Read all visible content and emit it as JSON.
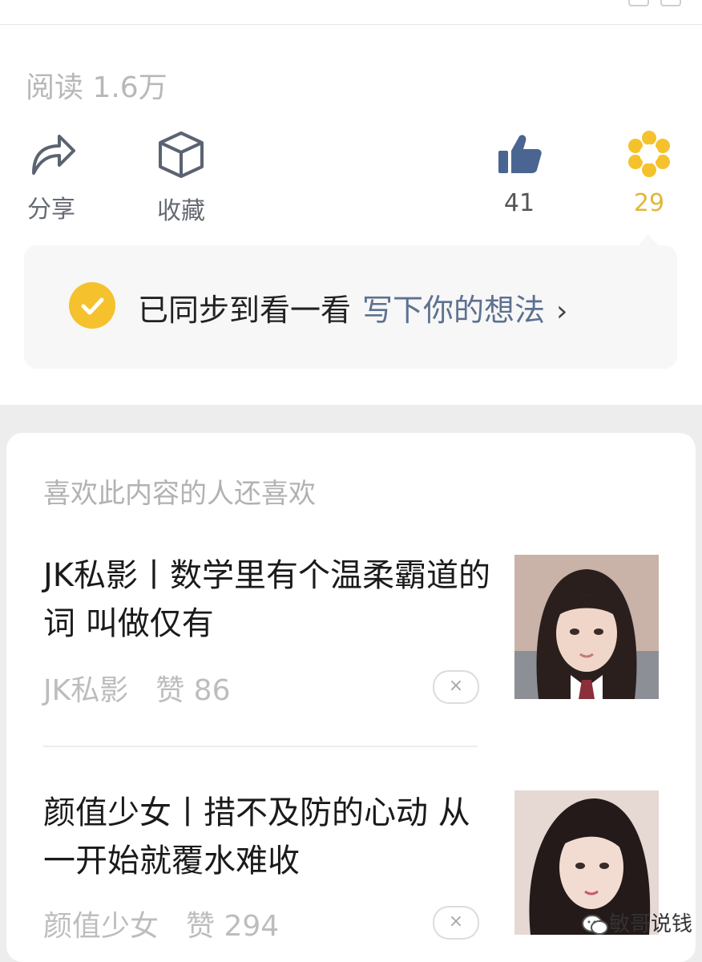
{
  "stats": {
    "read_label": "阅读 1.6万"
  },
  "actions": {
    "share_label": "分享",
    "favorite_label": "收藏",
    "like_count": "41",
    "wow_count": "29"
  },
  "comment_box": {
    "synced_text": "已同步到看一看",
    "write_link": "写下你的想法",
    "arrow": "›"
  },
  "recommendations": {
    "heading": "喜欢此内容的人还喜欢",
    "items": [
      {
        "title": "JK私影丨数学里有个温柔霸道的词 叫做仅有",
        "author": "JK私影",
        "likes": "赞 86",
        "dismiss": "×"
      },
      {
        "title": "颜值少女丨措不及防的心动 从一开始就覆水难收",
        "author": "颜值少女",
        "likes": "赞 294",
        "dismiss": "×"
      }
    ]
  },
  "watermark": "敏哥说钱",
  "colors": {
    "accent_yellow": "#f5c22d",
    "like_blue": "#4a6591",
    "link_gray_blue": "#5d7190"
  }
}
